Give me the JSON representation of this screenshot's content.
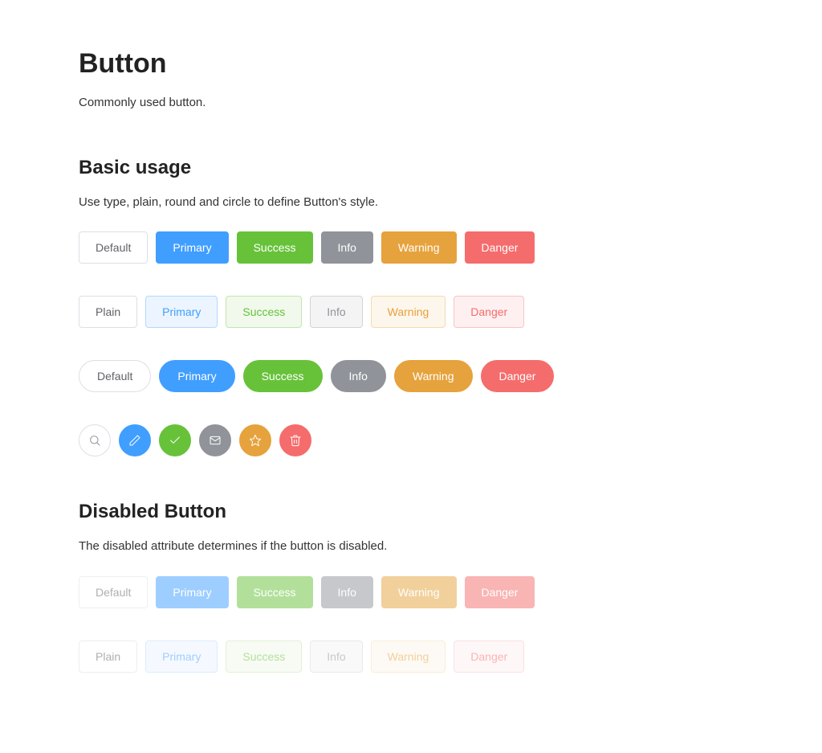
{
  "title": "Button",
  "intro": "Commonly used button.",
  "basic": {
    "heading": "Basic usage",
    "desc": "Use type, plain, round and circle to define Button's style.",
    "row1": {
      "default": "Default",
      "primary": "Primary",
      "success": "Success",
      "info": "Info",
      "warning": "Warning",
      "danger": "Danger"
    },
    "row2": {
      "plain": "Plain",
      "primary": "Primary",
      "success": "Success",
      "info": "Info",
      "warning": "Warning",
      "danger": "Danger"
    },
    "row3": {
      "default": "Default",
      "primary": "Primary",
      "success": "Success",
      "info": "Info",
      "warning": "Warning",
      "danger": "Danger"
    }
  },
  "disabled": {
    "heading": "Disabled Button",
    "desc": "The disabled attribute determines if the button is disabled.",
    "row1": {
      "default": "Default",
      "primary": "Primary",
      "success": "Success",
      "info": "Info",
      "warning": "Warning",
      "danger": "Danger"
    },
    "row2": {
      "plain": "Plain",
      "primary": "Primary",
      "success": "Success",
      "info": "Info",
      "warning": "Warning",
      "danger": "Danger"
    }
  },
  "icons": {
    "search": "search-icon",
    "edit": "edit-icon",
    "check": "check-icon",
    "mail": "mail-icon",
    "star": "star-icon",
    "delete": "delete-icon"
  }
}
